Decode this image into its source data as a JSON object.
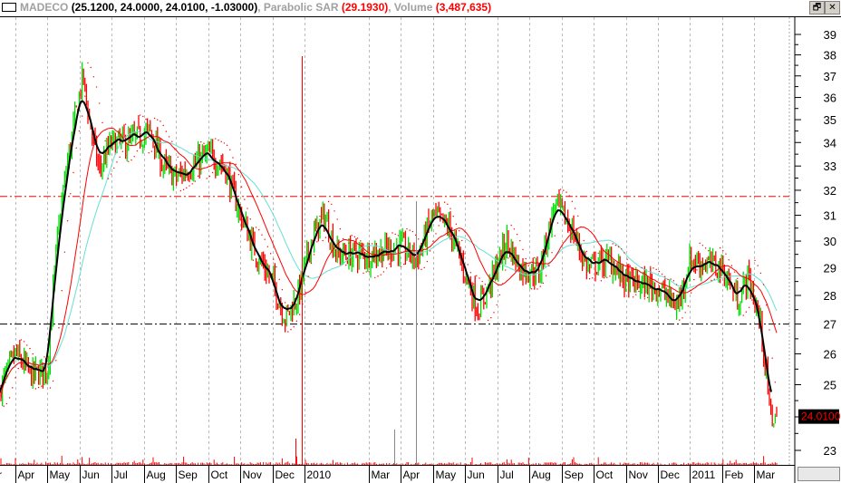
{
  "header": {
    "symbol": "MADECO",
    "ohlc": "(25.1200, 24.0000, 24.0100, -1.03000)",
    "sar_label": ", Parabolic SAR ",
    "sar_value": "(29.1930)",
    "volume_label": ", Volume ",
    "volume_value": "(3,487,635)"
  },
  "window_buttons": {
    "restore": "🗗",
    "close": "✕"
  },
  "chart_data": {
    "type": "ohlc",
    "title": "MADECO",
    "y_scale": "log",
    "ylim": [
      23,
      39
    ],
    "y_ticks": [
      39,
      38,
      37,
      36,
      35,
      34,
      33,
      32,
      31,
      30,
      29,
      28,
      27,
      26,
      25,
      23
    ],
    "x_ticks": [
      "Apr",
      "May",
      "Jun",
      "Jul",
      "Aug",
      "Sep",
      "Oct",
      "Nov",
      "Dec",
      "2010",
      "Mar",
      "Apr",
      "May",
      "Jun",
      "Jul",
      "Aug",
      "Sep",
      "Oct",
      "Nov",
      "Dec",
      "2011",
      "Feb",
      "Mar"
    ],
    "x_tick_month_index": [
      0,
      1,
      2,
      3,
      4,
      5,
      6,
      7,
      8,
      9,
      11,
      12,
      13,
      14,
      15,
      16,
      17,
      18,
      19,
      20,
      21,
      22,
      23
    ],
    "price_path_month_index_vs_price": [
      [
        -0.5,
        24.8
      ],
      [
        0,
        26
      ],
      [
        0.5,
        25.3
      ],
      [
        1,
        25.5
      ],
      [
        1.3,
        30
      ],
      [
        1.6,
        33
      ],
      [
        2.1,
        37
      ],
      [
        2.3,
        35
      ],
      [
        2.6,
        32.8
      ],
      [
        3,
        34
      ],
      [
        3.5,
        34
      ],
      [
        4.2,
        34.5
      ],
      [
        4.6,
        33
      ],
      [
        5,
        32.5
      ],
      [
        6,
        33.5
      ],
      [
        6.5,
        33
      ],
      [
        7,
        31
      ],
      [
        7.5,
        29.5
      ],
      [
        8,
        28.5
      ],
      [
        8.4,
        27.2
      ],
      [
        8.8,
        28
      ],
      [
        9.2,
        30
      ],
      [
        9.6,
        31
      ],
      [
        10,
        29.5
      ],
      [
        11,
        29.5
      ],
      [
        12,
        29.8
      ],
      [
        12.5,
        29.3
      ],
      [
        13,
        31
      ],
      [
        13.5,
        30.5
      ],
      [
        14,
        28.8
      ],
      [
        14.4,
        27.5
      ],
      [
        14.8,
        28.5
      ],
      [
        15.3,
        30
      ],
      [
        15.7,
        29
      ],
      [
        16.3,
        28.8
      ],
      [
        16.8,
        31.5
      ],
      [
        17.3,
        30.5
      ],
      [
        17.8,
        29
      ],
      [
        18.5,
        29.3
      ],
      [
        19,
        28.5
      ],
      [
        20,
        28.3
      ],
      [
        20.6,
        27.6
      ],
      [
        21,
        29.3
      ],
      [
        22,
        29
      ],
      [
        22.5,
        27.8
      ],
      [
        22.8,
        28.7
      ],
      [
        23.2,
        27
      ],
      [
        23.4,
        25
      ],
      [
        23.5,
        24.01
      ]
    ],
    "levels": [
      {
        "price": 31.75,
        "color": "#ff0000"
      },
      {
        "price": 27.0,
        "color": "#000000"
      }
    ],
    "last_price": "24.0100",
    "series": [
      {
        "name": "Price up",
        "color": "#00e000"
      },
      {
        "name": "Price down",
        "color": "#ff0000"
      },
      {
        "name": "Short MA",
        "color": "#000000"
      },
      {
        "name": "Medium MA",
        "color": "#ff0000"
      },
      {
        "name": "Long MA",
        "color": "#66e0d0"
      },
      {
        "name": "Parabolic SAR",
        "color": "#ff0000"
      },
      {
        "name": "Volume",
        "color": "#ff0000"
      }
    ]
  }
}
